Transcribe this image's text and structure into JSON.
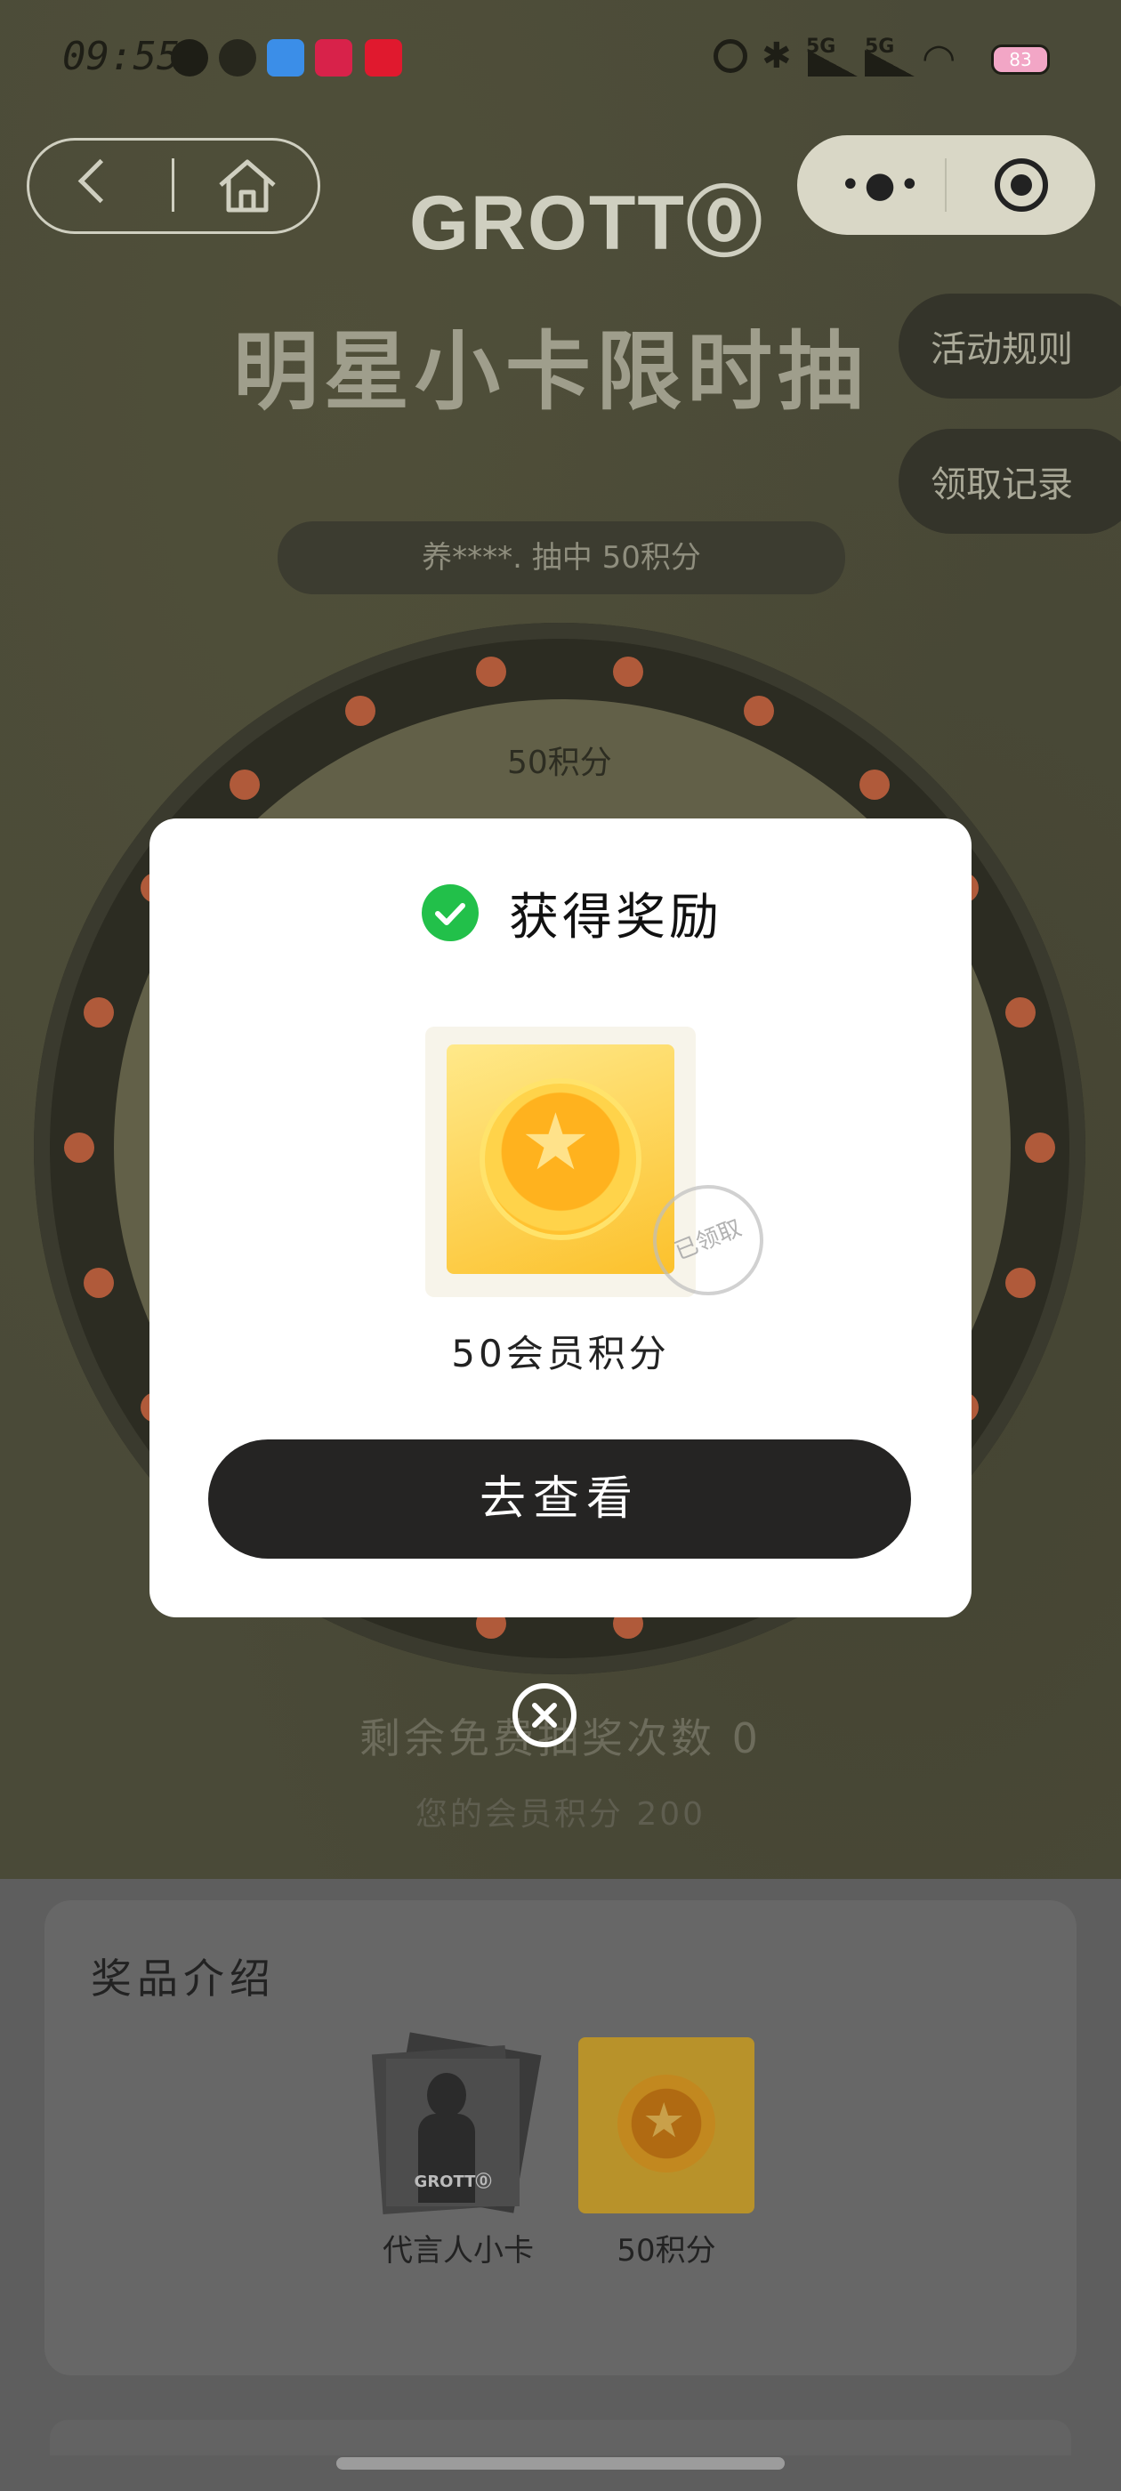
{
  "status_bar": {
    "time": "09:55",
    "network_1": "5G",
    "network_2": "5G",
    "battery": "83"
  },
  "header": {
    "logo": "GROTT⓪"
  },
  "page": {
    "title": "明星小卡限时抽",
    "rules_label": "活动规则",
    "records_label": "领取记录",
    "win_banner": "养****. 抽中  50积分",
    "wheel_slot_label": "50积分",
    "free_chances": "剩余免费抽奖次数 0",
    "member_points": "您的会员积分 200"
  },
  "prize_intro": {
    "title": "奖品介绍",
    "items": [
      {
        "label": "代言人小卡",
        "icon": "photo-card-icon"
      },
      {
        "label": "50积分",
        "icon": "coin-star-icon"
      }
    ],
    "card_logo": "GROTT⓪"
  },
  "modal": {
    "title": "获得奖励",
    "reward_name": "50会员积分",
    "stamp_text": "已领取",
    "view_button_label": "去查看"
  },
  "colors": {
    "accent_green": "#22c04a",
    "button_dark": "#252423",
    "coin_gold": "#ffb21e"
  }
}
